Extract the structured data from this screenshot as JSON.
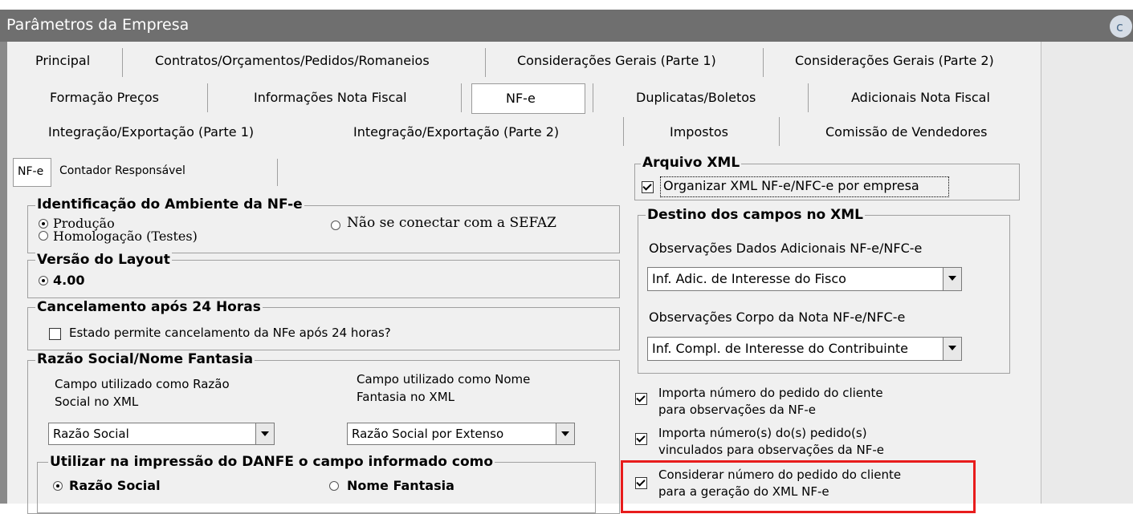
{
  "window": {
    "title": "Parâmetros da Empresa"
  },
  "tabs": {
    "row1": [
      "Principal",
      "Contratos/Orçamentos/Pedidos/Romaneios",
      "Considerações Gerais (Parte 1)",
      "Considerações Gerais (Parte 2)"
    ],
    "row2": [
      "Formação Preços",
      "Informações Nota Fiscal",
      "NF-e",
      "Duplicatas/Boletos",
      "Adicionais Nota Fiscal"
    ],
    "row3": [
      "Integração/Exportação (Parte 1)",
      "Integração/Exportação (Parte 2)",
      "Impostos",
      "Comissão de Vendedores"
    ],
    "selected": "NF-e"
  },
  "subtabs": {
    "items": [
      "NF-e",
      "Contador Responsável"
    ],
    "selected": "NF-e"
  },
  "ambiente": {
    "title": "Identificação do Ambiente da NF-e",
    "options": [
      "Produção",
      "Homologação (Testes)",
      "Não se conectar com a SEFAZ"
    ],
    "selected": "Produção"
  },
  "layout": {
    "title": "Versão do Layout",
    "options": [
      "4.00"
    ],
    "selected": "4.00"
  },
  "cancelamento": {
    "title": "Cancelamento após 24 Horas",
    "checkbox_label": "Estado permite cancelamento da NFe após 24 horas?",
    "checked": false
  },
  "razao": {
    "title": "Razão Social/Nome Fantasia",
    "campo_razao_label": "Campo utilizado como Razão Social no XML",
    "campo_razao_value": "Razão Social",
    "campo_fantasia_label": "Campo utilizado como Nome Fantasia no XML",
    "campo_fantasia_value": "Razão Social por Extenso",
    "danfe_title": "Utilizar na impressão do DANFE o campo informado como",
    "danfe_options": [
      "Razão Social",
      "Nome Fantasia"
    ],
    "danfe_selected": "Razão Social"
  },
  "arquivo_xml": {
    "title": "Arquivo XML",
    "checkbox_label": "Organizar XML NF-e/NFC-e por empresa",
    "checked": true
  },
  "destino": {
    "title": "Destino dos campos no XML",
    "obs_adic_label": "Observações Dados Adicionais NF-e/NFC-e",
    "obs_adic_value": "Inf. Adic. de Interesse do Fisco",
    "obs_corpo_label": "Observações Corpo da Nota NF-e/NFC-e",
    "obs_corpo_value": "Inf. Compl. de Interesse do Contribuinte"
  },
  "opcoes": [
    {
      "line1": "Importa número do pedido do cliente",
      "line2": "para observações da NF-e",
      "checked": true
    },
    {
      "line1": "Importa número(s) do(s) pedido(s)",
      "line2": "vinculados para observações da NF-e",
      "checked": true
    },
    {
      "line1": "Considerar número do pedido do cliente",
      "line2": "para a geração do XML NF-e",
      "checked": true
    }
  ],
  "colors": {
    "titlebar": "#6f6f6f",
    "window": "#f0f0f0",
    "highlight": "#e81c1c"
  }
}
